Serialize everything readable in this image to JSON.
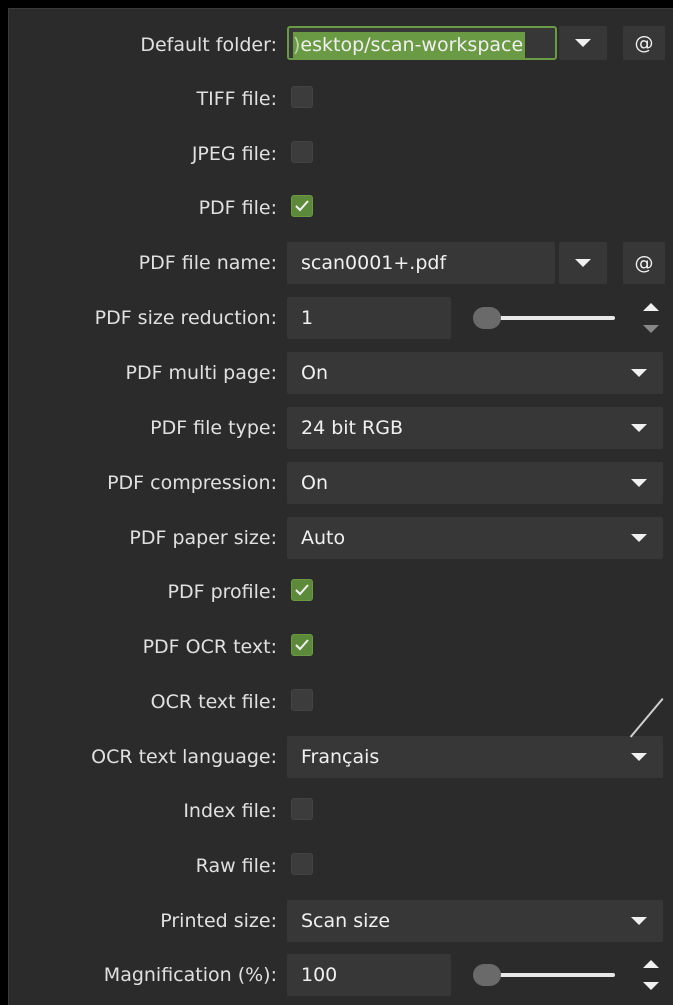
{
  "rows": {
    "default_folder": {
      "label": "Default folder:",
      "value": "esktop/scan-workspace",
      "cutoff_glyph": ")"
    },
    "tiff": {
      "label": "TIFF file:",
      "checked": false
    },
    "jpeg": {
      "label": "JPEG file:",
      "checked": false
    },
    "pdf": {
      "label": "PDF file:",
      "checked": true
    },
    "pdf_file_name": {
      "label": "PDF file name:",
      "value": "scan0001+.pdf"
    },
    "pdf_size_reduction": {
      "label": "PDF size reduction:",
      "value": "1"
    },
    "pdf_multi_page": {
      "label": "PDF multi page:",
      "value": "On"
    },
    "pdf_file_type": {
      "label": "PDF file type:",
      "value": "24 bit RGB"
    },
    "pdf_compression": {
      "label": "PDF compression:",
      "value": "On"
    },
    "pdf_paper_size": {
      "label": "PDF paper size:",
      "value": "Auto"
    },
    "pdf_profile": {
      "label": "PDF profile:",
      "checked": true
    },
    "pdf_ocr_text": {
      "label": "PDF OCR text:",
      "checked": true
    },
    "ocr_text_file": {
      "label": "OCR text file:",
      "checked": false
    },
    "ocr_text_language": {
      "label": "OCR text language:",
      "value": "Français"
    },
    "index_file": {
      "label": "Index file:",
      "checked": false
    },
    "raw_file": {
      "label": "Raw file:",
      "checked": false
    },
    "printed_size": {
      "label": "Printed size:",
      "value": "Scan size"
    },
    "magnification": {
      "label": "Magnification (%):",
      "value": "100"
    }
  },
  "buttons": {
    "at_symbol": "@"
  },
  "colors": {
    "accent": "#6b9a45",
    "panel": "#2b2b2b",
    "control": "#373737"
  }
}
